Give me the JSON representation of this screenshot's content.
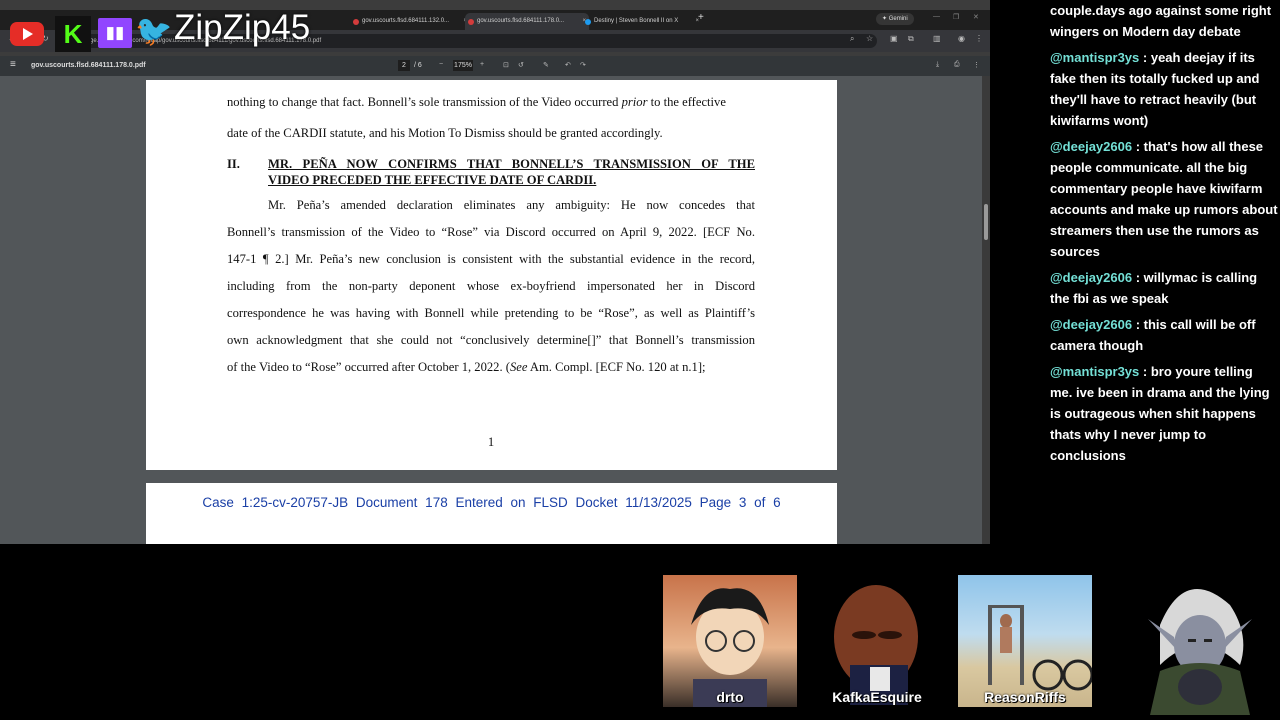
{
  "stream": {
    "handle": "ZipZip45"
  },
  "browser": {
    "tabs": [
      {
        "label": "gov.uscourts.flsd.684111.132.0..."
      },
      {
        "label": "gov.uscourts.flsd.684111.178.0..."
      },
      {
        "label": "Destiny | Steven Bonnell II on X"
      }
    ],
    "gemini_label": "Gemini",
    "url": "ge.courtlistener.com/recap/gov.uscourts.flsd.684111/gov.uscourts.flsd.684111.178.0.pdf"
  },
  "pdf": {
    "filename": "gov.uscourts.flsd.684111.178.0.pdf",
    "current_page": "2",
    "total_pages": "/ 6",
    "zoom": "175%",
    "page_text": {
      "line1a": "nothing to change that fact. Bonnell’s sole transmission of the Video occurred ",
      "line1b": "prior",
      "line1c": " to the effective",
      "line2": "date of the CARDII statute, and his Motion To Dismiss should be granted accordingly.",
      "heading_num": "II.",
      "heading_line1": "MR. PEÑA NOW CONFIRMS THAT BONNELL’S TRANSMISSION OF THE",
      "heading_line2": "VIDEO PRECEDED THE EFFECTIVE DATE OF CARDII.",
      "p1": "Mr. Peña’s amended declaration eliminates any ambiguity: He now concedes that",
      "p2": "Bonnell’s transmission of the Video to “Rose” via Discord occurred on April 9, 2022. [ECF No.",
      "p3": "147-1 ¶ 2.] Mr. Peña’s new conclusion is consistent with the substantial evidence in the record,",
      "p4": "including from the non-party deponent whose ex-boyfriend impersonated her in Discord",
      "p5": "correspondence he was having with Bonnell while pretending to be “Rose”, as well as Plaintiff’s",
      "p6": "own acknowledgment that she could not “conclusively determine[]” that Bonnell’s transmission",
      "p7a": "of the Video to “Rose” occurred after October 1, 2022. (",
      "p7b": "See",
      "p7c": " Am. Compl. [ECF No. 120 at n.1];",
      "page_number": "1"
    },
    "next_page_header": "Case 1:25-cv-20757-JB   Document 178   Entered on FLSD Docket 11/13/2025   Page 3 of 6"
  },
  "chat": [
    {
      "user": "",
      "text": "couple.days ago against some right wingers on Modern day debate"
    },
    {
      "user": "@mantispr3ys",
      "text": " : yeah deejay if its fake then its totally fucked up and they'll have to retract heavily (but kiwifarms wont)"
    },
    {
      "user": "@deejay2606",
      "text": " : that's how all these people communicate. all the big commentary people have kiwifarm accounts and make up rumors about streamers then use the rumors as sources"
    },
    {
      "user": "@deejay2606",
      "text": " : willymac is calling the fbi as we speak"
    },
    {
      "user": "@deejay2606",
      "text": " : this call will be off camera though"
    },
    {
      "user": "@mantispr3ys",
      "text": " : bro youre telling me. ive been in drama and the lying is outrageous when shit happens thats why I never jump to conclusions"
    }
  ],
  "webcams": [
    {
      "name": "drto"
    },
    {
      "name": "KafkaEsquire"
    },
    {
      "name": "ReasonRiffs"
    }
  ],
  "colors": {
    "chat_username": "#74e0d6",
    "case_header": "#1a3fa6",
    "viewer_bg": "#525659"
  }
}
